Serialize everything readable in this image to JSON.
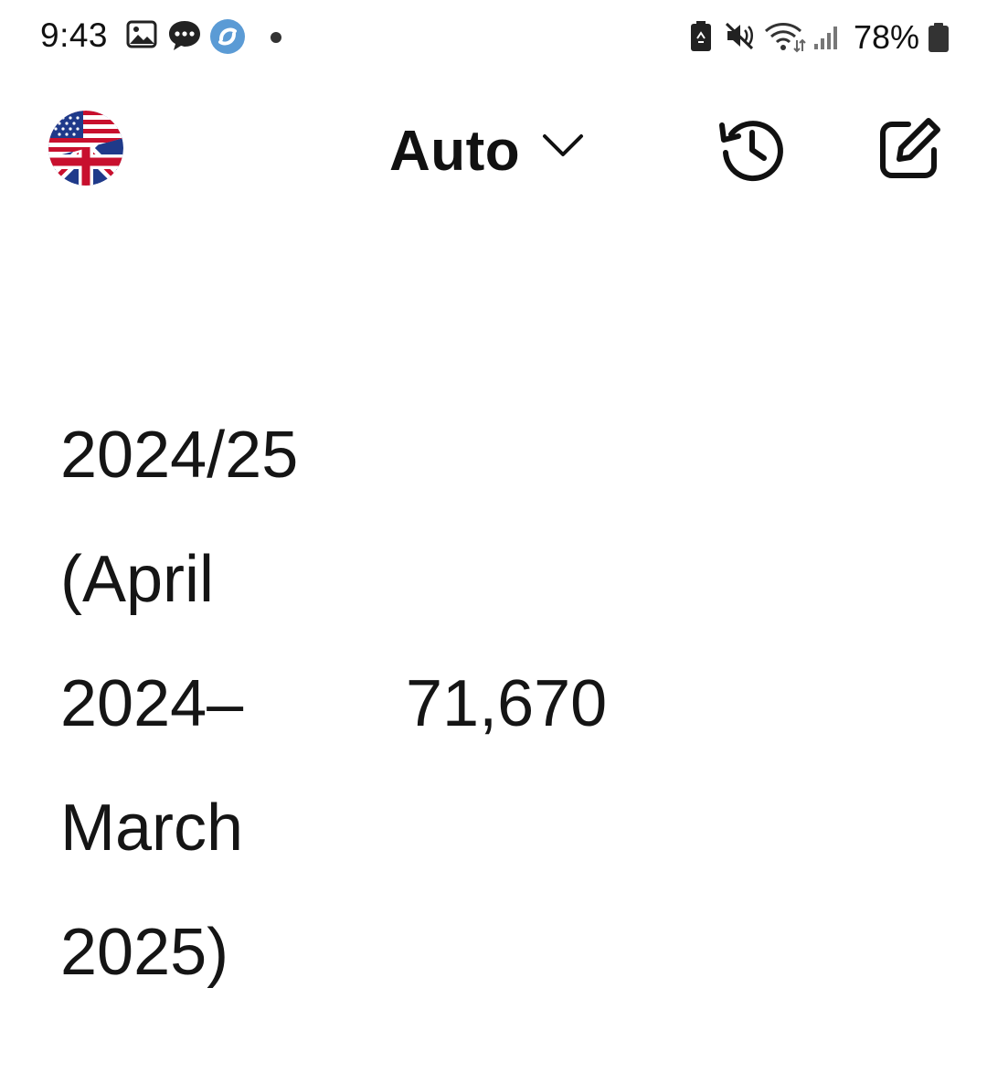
{
  "status_bar": {
    "time": "9:43",
    "notification_icons": [
      "gallery-icon",
      "messages-icon",
      "app-notification-icon",
      "more-notifications-dot"
    ],
    "system_icons": [
      "battery-saver-icon",
      "mute-icon",
      "wifi-icon",
      "signal-icon",
      "battery-icon"
    ],
    "battery_percent": "78%"
  },
  "app_bar": {
    "language_flag": "us-uk-flag",
    "mode_label": "Auto",
    "actions": [
      "history-icon",
      "edit-icon"
    ]
  },
  "content": {
    "period_lines": [
      "2024/25",
      "(April",
      "2024–",
      "March",
      "2025)"
    ],
    "value": "71,670"
  },
  "colors": {
    "background": "#ffffff",
    "text": "#151515",
    "app_icon_blue": "#5b9bd5"
  }
}
